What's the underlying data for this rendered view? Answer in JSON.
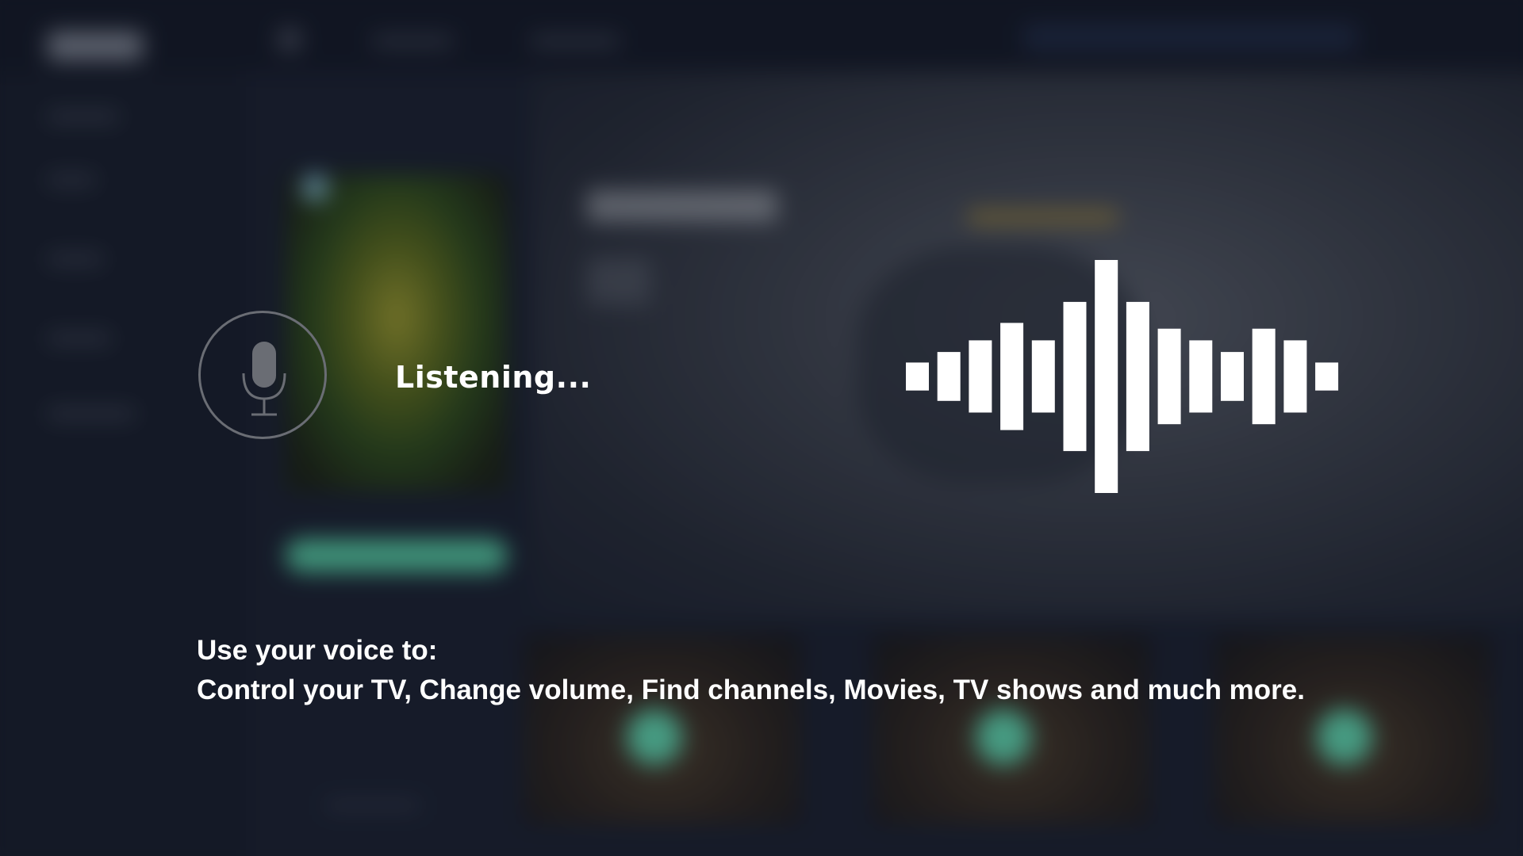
{
  "voice_overlay": {
    "status_text": "Listening...",
    "hint_line_1": "Use your voice to:",
    "hint_line_2": "Control your TV, Change volume, Find channels, Movies, TV shows  and much more.",
    "mic_icon": "microphone-icon",
    "waveform_icon": "audio-waveform-icon",
    "waveform_levels": [
      0.12,
      0.21,
      0.31,
      0.46,
      0.31,
      0.64,
      1.0,
      0.64,
      0.41,
      0.31,
      0.21,
      0.41,
      0.31,
      0.12
    ]
  },
  "colors": {
    "overlay_text": "#ffffff",
    "mic_ring": "#6a6d74",
    "accent_green": "#55c9a1",
    "accent_gold": "#a48a3c",
    "background": "#161c29"
  }
}
